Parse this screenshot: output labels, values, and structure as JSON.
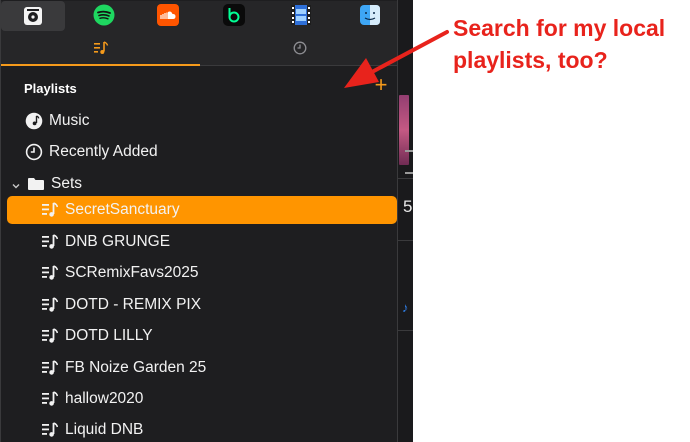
{
  "source_bar": {
    "icons": [
      "music-player-icon",
      "spotify-icon",
      "soundcloud-icon",
      "beatport-icon",
      "film-icon",
      "finder-icon"
    ]
  },
  "tabs": [
    {
      "icon": "playlist-note-icon",
      "active": true
    },
    {
      "icon": "clock-icon",
      "active": false
    }
  ],
  "list": {
    "header": "Playlists",
    "add_symbol": "+",
    "items": [
      {
        "label": "Music",
        "icon": "music-note-circle-icon",
        "selected": false
      },
      {
        "label": "Recently Added",
        "icon": "clock-icon",
        "selected": false
      },
      {
        "label": "Sets",
        "icon": "folder-icon",
        "selected": false
      },
      {
        "label": "SecretSanctuary",
        "icon": "playlist-icon",
        "selected": true
      },
      {
        "label": "DNB GRUNGE",
        "icon": "playlist-icon",
        "selected": false
      },
      {
        "label": "SCRemixFavs2025",
        "icon": "playlist-icon",
        "selected": false
      },
      {
        "label": "DOTD - REMIX PIX",
        "icon": "playlist-icon",
        "selected": false
      },
      {
        "label": "DOTD LILLY",
        "icon": "playlist-icon",
        "selected": false
      },
      {
        "label": "FB Noize Garden 25",
        "icon": "playlist-icon",
        "selected": false
      },
      {
        "label": "hallow2020",
        "icon": "playlist-icon",
        "selected": false
      },
      {
        "label": "Liquid DNB",
        "icon": "playlist-icon",
        "selected": false
      }
    ]
  },
  "background_app": {
    "digit": "5"
  },
  "annotation": {
    "text": "Search for my local playlists, too?"
  },
  "colors": {
    "accent": "#ff9500",
    "annotation": "#e8231c",
    "panel_bg": "#1e1e20"
  }
}
